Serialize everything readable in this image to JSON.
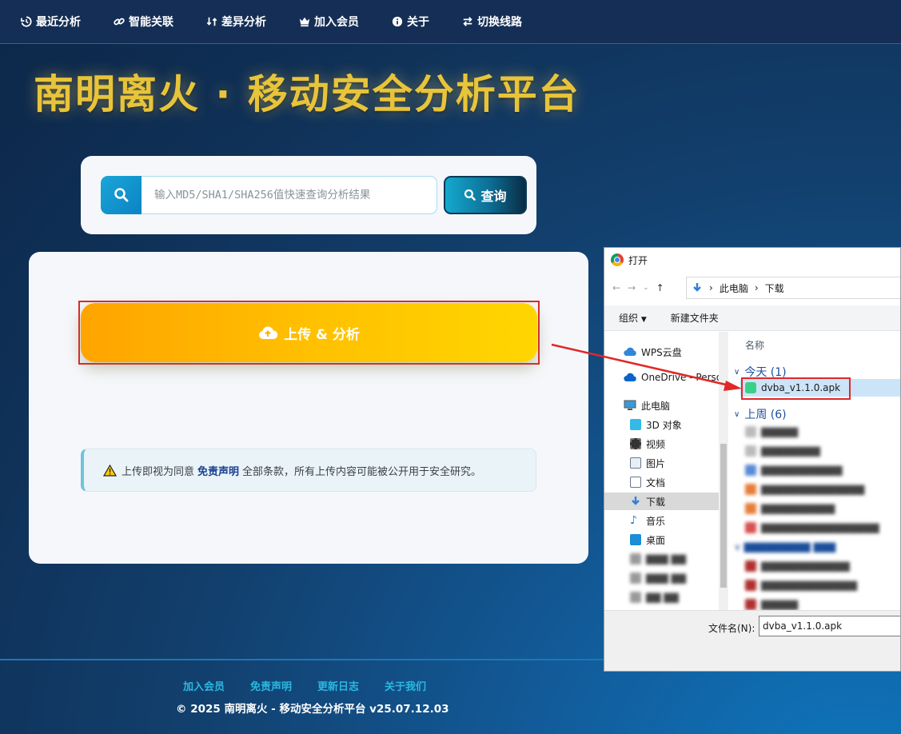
{
  "nav": {
    "items": [
      {
        "label": "最近分析",
        "icon": "history-icon"
      },
      {
        "label": "智能关联",
        "icon": "link-icon"
      },
      {
        "label": "差异分析",
        "icon": "diff-icon"
      },
      {
        "label": "加入会员",
        "icon": "crown-icon"
      },
      {
        "label": "关于",
        "icon": "info-icon"
      },
      {
        "label": "切换线路",
        "icon": "switch-icon"
      }
    ]
  },
  "page": {
    "title": "南明离火 · 移动安全分析平台"
  },
  "search": {
    "placeholder": "输入MD5/SHA1/SHA256值快速查询分析结果",
    "button_label": "查询"
  },
  "upload": {
    "button_label": "上传 & 分析"
  },
  "notice": {
    "prefix": "上传即视为同意",
    "link": "免责声明",
    "suffix": "全部条款，所有上传内容可能被公开用于安全研究。"
  },
  "footer": {
    "links": [
      "加入会员",
      "免责声明",
      "更新日志",
      "关于我们"
    ],
    "copyright": "© 2025 南明离火 - 移动安全分析平台 v25.07.12.03"
  },
  "dialog": {
    "title": "打开",
    "path": [
      "此电脑",
      "下载"
    ],
    "toolbar": {
      "organize": "组织",
      "new_folder": "新建文件夹"
    },
    "column_header": "名称",
    "sidebar": [
      {
        "label": "WPS云盘",
        "icon": "cloud-icon"
      },
      {
        "label": "OneDrive - Perso",
        "icon": "onedrive-icon"
      },
      {
        "label": "此电脑",
        "icon": "computer-icon"
      },
      {
        "label": "3D 对象",
        "icon": "cube-icon"
      },
      {
        "label": "视频",
        "icon": "video-icon"
      },
      {
        "label": "图片",
        "icon": "picture-icon"
      },
      {
        "label": "文档",
        "icon": "document-icon"
      },
      {
        "label": "下载",
        "icon": "download-icon"
      },
      {
        "label": "音乐",
        "icon": "music-icon"
      },
      {
        "label": "桌面",
        "icon": "desktop-icon"
      }
    ],
    "groups": [
      {
        "label": "今天 (1)"
      },
      {
        "label": "上周 (6)"
      }
    ],
    "selected_file": "dvba_v1.1.0.apk",
    "filename_label": "文件名(N):",
    "filename_value": "dvba_v1.1.0.apk"
  }
}
